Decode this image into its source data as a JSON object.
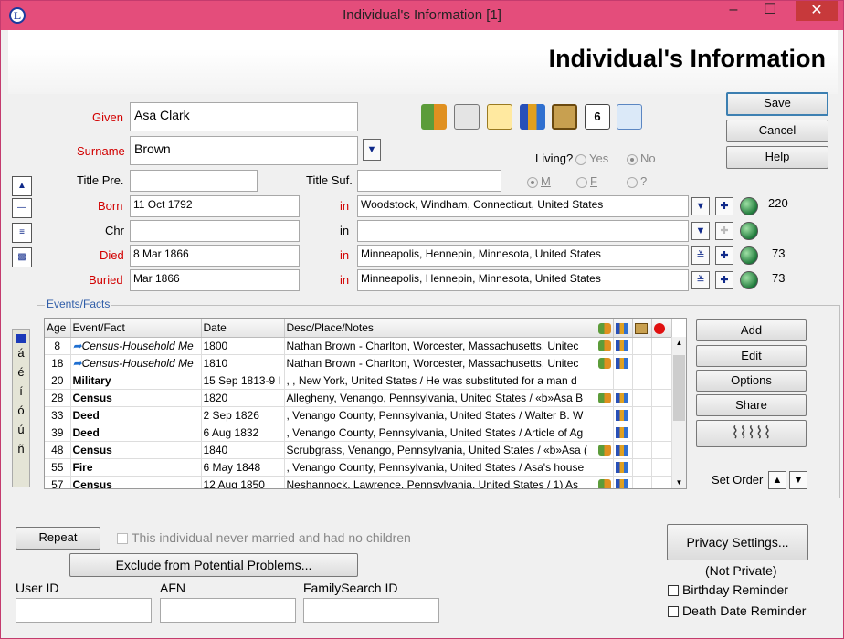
{
  "window": {
    "title": "Individual's Information  [1]",
    "app_icon": "L",
    "min": "–",
    "max": "☐",
    "close": "✕"
  },
  "header": {
    "title": "Individual's Information"
  },
  "fields": {
    "given_label": "Given",
    "given": "Asa Clark",
    "surname_label": "Surname",
    "surname": "Brown",
    "title_pre_label": "Title Pre.",
    "title_pre": "",
    "title_suf_label": "Title Suf.",
    "title_suf": "",
    "living_label": "Living?",
    "yes": "Yes",
    "no": "No",
    "sex_m": "M",
    "sex_f": "F",
    "sex_q": "?"
  },
  "events": {
    "born_label": "Born",
    "born_date": "11 Oct 1792",
    "born_place": "Woodstock, Windham, Connecticut, United States",
    "born_num": "220",
    "chr_label": "Chr",
    "chr_date": "",
    "chr_place": "",
    "died_label": "Died",
    "died_date": "8 Mar 1866",
    "died_place": "Minneapolis, Hennepin, Minnesota, United States",
    "died_num": "73",
    "buried_label": "Buried",
    "buried_date": "Mar 1866",
    "buried_place": "Minneapolis, Hennepin, Minnesota, United States",
    "buried_num": "73",
    "in": "in"
  },
  "buttons": {
    "save": "Save",
    "cancel": "Cancel",
    "help": "Help",
    "add": "Add",
    "edit": "Edit",
    "options": "Options",
    "share": "Share",
    "set_order": "Set Order",
    "repeat": "Repeat",
    "exclude": "Exclude from Potential Problems...",
    "privacy": "Privacy Settings..."
  },
  "facts": {
    "caption": "Events/Facts",
    "columns": [
      "Age",
      "Event/Fact",
      "Date",
      "Desc/Place/Notes"
    ],
    "rows": [
      {
        "age": "8",
        "event": "Census-Household Me",
        "date": "1800",
        "desc": "Nathan Brown - Charlton, Worcester, Massachusetts, Unitec"
      },
      {
        "age": "18",
        "event": "Census-Household Me",
        "date": "1810",
        "desc": "Nathan Brown - Charlton, Worcester, Massachusetts, Unitec"
      },
      {
        "age": "20",
        "event": "Military",
        "date": "15 Sep 1813-9 I",
        "desc": ", , New York, United States / He was substituted for a man d"
      },
      {
        "age": "28",
        "event": "Census",
        "date": "1820",
        "desc": "Allegheny, Venango, Pennsylvania, United States / «b»Asa B"
      },
      {
        "age": "33",
        "event": "Deed",
        "date": "2 Sep 1826",
        "desc": ", Venango County, Pennsylvania, United States / Walter B. W"
      },
      {
        "age": "39",
        "event": "Deed",
        "date": "6 Aug 1832",
        "desc": ", Venango County, Pennsylvania, United States / Article of Ag"
      },
      {
        "age": "48",
        "event": "Census",
        "date": "1840",
        "desc": "Scrubgrass, Venango, Pennsylvania, United States / «b»Asa ("
      },
      {
        "age": "55",
        "event": "Fire",
        "date": "6 May 1848",
        "desc": ", Venango County, Pennsylvania, United States / Asa's house"
      },
      {
        "age": "57",
        "event": "Census",
        "date": "12 Aug 1850",
        "desc": "Neshannock, Lawrence, Pennsylvania, United States /  1) As"
      }
    ]
  },
  "accent_chars": [
    "á",
    "é",
    "í",
    "ó",
    "ú",
    "ñ"
  ],
  "never_married": "This individual never married and had no children",
  "ids": {
    "user_id": "User ID",
    "afn": "AFN",
    "familysearch_id": "FamilySearch ID"
  },
  "privacy_status": "(Not Private)",
  "reminders": {
    "birthday": "Birthday Reminder",
    "death": "Death Date Reminder"
  }
}
